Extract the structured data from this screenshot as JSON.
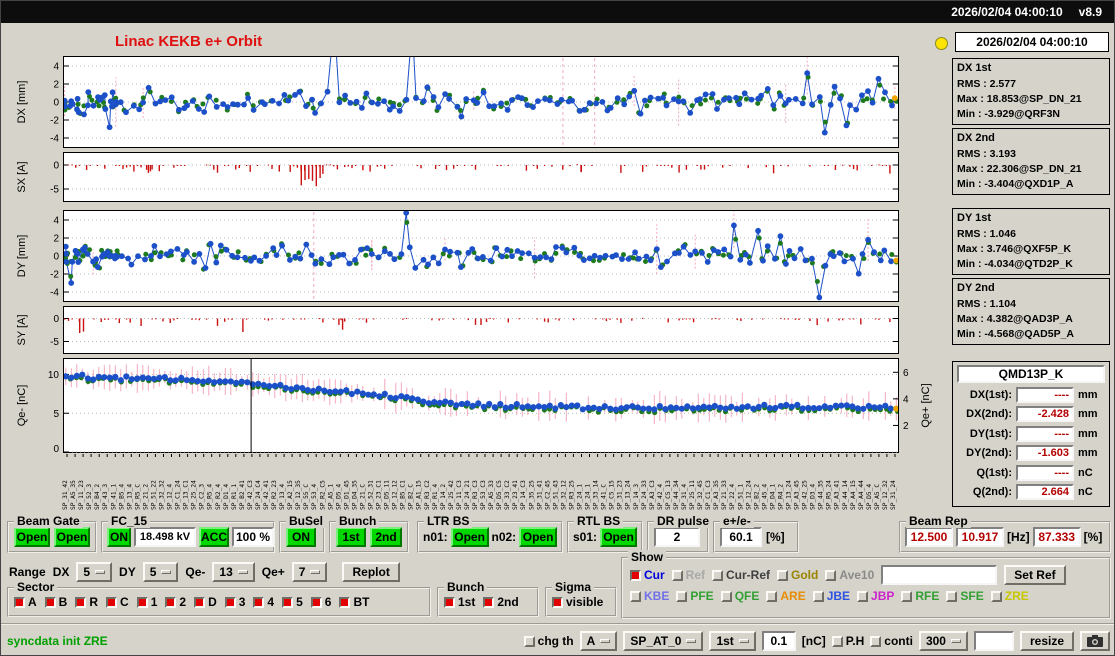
{
  "titlebar": {
    "datetime": "2026/02/04 04:00:10",
    "version": "v8.9"
  },
  "header": {
    "title": "Linac KEKB e+ Orbit",
    "timestamp": "2026/02/04 04:00:10"
  },
  "stats": [
    {
      "label": "DX 1st",
      "rms": "RMS : 2.577",
      "max": "Max : 18.853@SP_DN_21",
      "min": "Min : -3.929@QRF3N"
    },
    {
      "label": "DX 2nd",
      "rms": "RMS : 3.193",
      "max": "Max : 22.306@SP_DN_21",
      "min": "Min : -3.404@QXD1P_A"
    },
    {
      "label": "DY 1st",
      "rms": "RMS : 1.046",
      "max": "Max : 3.746@QXF5P_K",
      "min": "Min : -4.034@QTD2P_K"
    },
    {
      "label": "DY 2nd",
      "rms": "RMS : 1.104",
      "max": "Max : 4.382@QAD3P_A",
      "min": "Min : -4.568@QAD5P_A"
    }
  ],
  "monitor": {
    "name": "QMD13P_K",
    "rows": [
      {
        "label": "DX(1st):",
        "value": "----",
        "unit": "mm"
      },
      {
        "label": "DX(2nd):",
        "value": "-2.428",
        "unit": "mm"
      },
      {
        "label": "DY(1st):",
        "value": "----",
        "unit": "mm"
      },
      {
        "label": "DY(2nd):",
        "value": "-1.603",
        "unit": "mm"
      },
      {
        "label": "Q(1st):",
        "value": "----",
        "unit": "nC"
      },
      {
        "label": "Q(2nd):",
        "value": "2.664",
        "unit": "nC"
      }
    ]
  },
  "groups": {
    "beam_gate": {
      "label": "Beam Gate",
      "b1": "Open",
      "b2": "Open"
    },
    "fc15": {
      "label": "FC_15",
      "on": "ON",
      "kv": "18.498 kV",
      "acc": "ACC",
      "pct": "100 %"
    },
    "busel": {
      "label": "BuSel",
      "on": "ON"
    },
    "bunch": {
      "label": "Bunch",
      "b1": "1st",
      "b2": "2nd"
    },
    "ltr": {
      "label": "LTR BS",
      "n01": "n01:",
      "n01v": "Open",
      "n02": "n02:",
      "n02v": "Open"
    },
    "rtl": {
      "label": "RTL BS",
      "s01": "s01:",
      "s01v": "Open"
    },
    "dr": {
      "label": "DR pulse",
      "value": "2"
    },
    "ratio": {
      "label": "e+/e-",
      "value": "60.1",
      "unit": "[%]"
    },
    "beam_rep": {
      "label": "Beam Rep",
      "v1": "12.500",
      "v2": "10.917",
      "u1": "[Hz]",
      "v3": "87.333",
      "u2": "[%]"
    }
  },
  "range": {
    "label": "Range",
    "dx": "DX",
    "dxv": "5",
    "dy": "DY",
    "dyv": "5",
    "qm": "Qe-",
    "qmv": "13",
    "qp": "Qe+",
    "qpv": "7",
    "replot": "Replot"
  },
  "sector": {
    "label": "Sector",
    "items": [
      {
        "label": "A",
        "checked": true
      },
      {
        "label": "B",
        "checked": true
      },
      {
        "label": "R",
        "checked": true
      },
      {
        "label": "C",
        "checked": true
      },
      {
        "label": "1",
        "checked": true
      },
      {
        "label": "2",
        "checked": true
      },
      {
        "label": "D",
        "checked": true
      },
      {
        "label": "3",
        "checked": true
      },
      {
        "label": "4",
        "checked": true
      },
      {
        "label": "5",
        "checked": true
      },
      {
        "label": "6",
        "checked": true
      },
      {
        "label": "BT",
        "checked": true
      }
    ]
  },
  "bunch_sel": {
    "label": "Bunch",
    "items": [
      {
        "label": "1st",
        "checked": true
      },
      {
        "label": "2nd",
        "checked": true
      }
    ]
  },
  "sigma": {
    "label": "Sigma",
    "item": {
      "label": "visible",
      "checked": true
    }
  },
  "show": {
    "label": "Show",
    "set_ref": "Set Ref",
    "row1": [
      {
        "label": "Cur",
        "color": "#0000dd",
        "checked": true
      },
      {
        "label": "Ref",
        "color": "#a8a8a8",
        "checked": false
      },
      {
        "label": "Cur-Ref",
        "color": "#404040",
        "checked": false
      },
      {
        "label": "Gold",
        "color": "#9a8400",
        "checked": false
      },
      {
        "label": "Ave10",
        "color": "#8a8a8a",
        "checked": false
      }
    ],
    "row2": [
      {
        "label": "KBE",
        "color": "#7070e8",
        "checked": false
      },
      {
        "label": "PFE",
        "color": "#34a034",
        "checked": false
      },
      {
        "label": "QFE",
        "color": "#34a034",
        "checked": false
      },
      {
        "label": "ARE",
        "color": "#e88c00",
        "checked": false
      },
      {
        "label": "JBE",
        "color": "#2b52e0",
        "checked": false
      },
      {
        "label": "JBP",
        "color": "#cc22cc",
        "checked": false
      },
      {
        "label": "RFE",
        "color": "#34a034",
        "checked": false
      },
      {
        "label": "SFE",
        "color": "#34a034",
        "checked": false
      },
      {
        "label": "ZRE",
        "color": "#c8c800",
        "checked": false
      }
    ]
  },
  "statusbar": {
    "message": "syncdata init ZRE",
    "chg_th": "chg th",
    "chg_th_checked": false,
    "sel1": "A",
    "sel2": "SP_AT_0",
    "sel3": "1st",
    "thresh": "0.1",
    "thresh_unit": "[nC]",
    "ph": "P.H",
    "ph_checked": false,
    "conti": "conti",
    "conti_checked": false,
    "count": "300",
    "resize": "resize"
  },
  "charts": {
    "seed": 7,
    "colors": {
      "blue": "#1c50c8",
      "green": "#1e7a1e",
      "red": "#cc1111",
      "pink": "#f2a8bc",
      "orange": "#f0a800",
      "grid": "#b8b8b8"
    },
    "dx": {
      "ylabel": "DX [mm]",
      "range": [
        -5,
        5
      ],
      "ticks": [
        -4,
        -2,
        0,
        2,
        4
      ],
      "spikes": [
        [
          0.32,
          9
        ],
        [
          0.415,
          8.5
        ],
        [
          0.055,
          -2.8
        ],
        [
          0.885,
          3.2
        ],
        [
          0.905,
          -3.4
        ],
        [
          0.93,
          -2.6
        ]
      ],
      "pink_lines": [
        0.598,
        0.636
      ]
    },
    "sx": {
      "ylabel": "SX [A]",
      "range": [
        -7.5,
        2.5
      ],
      "ticks": [
        0,
        -5
      ],
      "bigs": [
        [
          0.285,
          -4.5,
          6
        ],
        [
          0.1,
          -1.8,
          2
        ],
        [
          0.62,
          -1.5,
          1
        ]
      ]
    },
    "dy": {
      "ylabel": "DY [mm]",
      "range": [
        -5,
        5
      ],
      "ticks": [
        -4,
        -2,
        0,
        2,
        4
      ],
      "spikes": [
        [
          0.005,
          -3
        ],
        [
          0.41,
          4.8
        ],
        [
          0.8,
          3.4
        ],
        [
          0.825,
          2.8
        ],
        [
          0.855,
          2.2
        ],
        [
          0.9,
          -4.6
        ],
        [
          0.96,
          1.8
        ]
      ],
      "pink_lines": [
        0.3
      ]
    },
    "sy": {
      "ylabel": "SY [A]",
      "range": [
        -7.5,
        2.5
      ],
      "ticks": [
        0,
        -5
      ],
      "bigs": [
        [
          0.02,
          -5,
          2
        ],
        [
          0.33,
          -2.5,
          2
        ],
        [
          0.5,
          -1.5,
          1
        ]
      ]
    },
    "q": {
      "ylabel": "Qe- [nC]",
      "range": [
        0,
        12
      ],
      "ticks": [
        0,
        5,
        10
      ],
      "y2label": "Qe+ [nC]",
      "y2range": [
        0,
        7
      ],
      "y2ticks": [
        2,
        4,
        6
      ],
      "cursor_x": 0.225,
      "profile": [
        [
          0,
          9.9
        ],
        [
          0.04,
          9.6
        ],
        [
          0.2,
          9.2
        ],
        [
          0.222,
          8.9
        ],
        [
          0.3,
          8.1
        ],
        [
          0.36,
          7.6
        ],
        [
          0.41,
          7.1
        ],
        [
          0.45,
          6.3
        ],
        [
          0.5,
          6.0
        ],
        [
          0.56,
          5.9
        ],
        [
          0.63,
          5.7
        ],
        [
          0.8,
          5.8
        ],
        [
          0.92,
          5.9
        ],
        [
          1,
          5.8
        ]
      ]
    }
  }
}
